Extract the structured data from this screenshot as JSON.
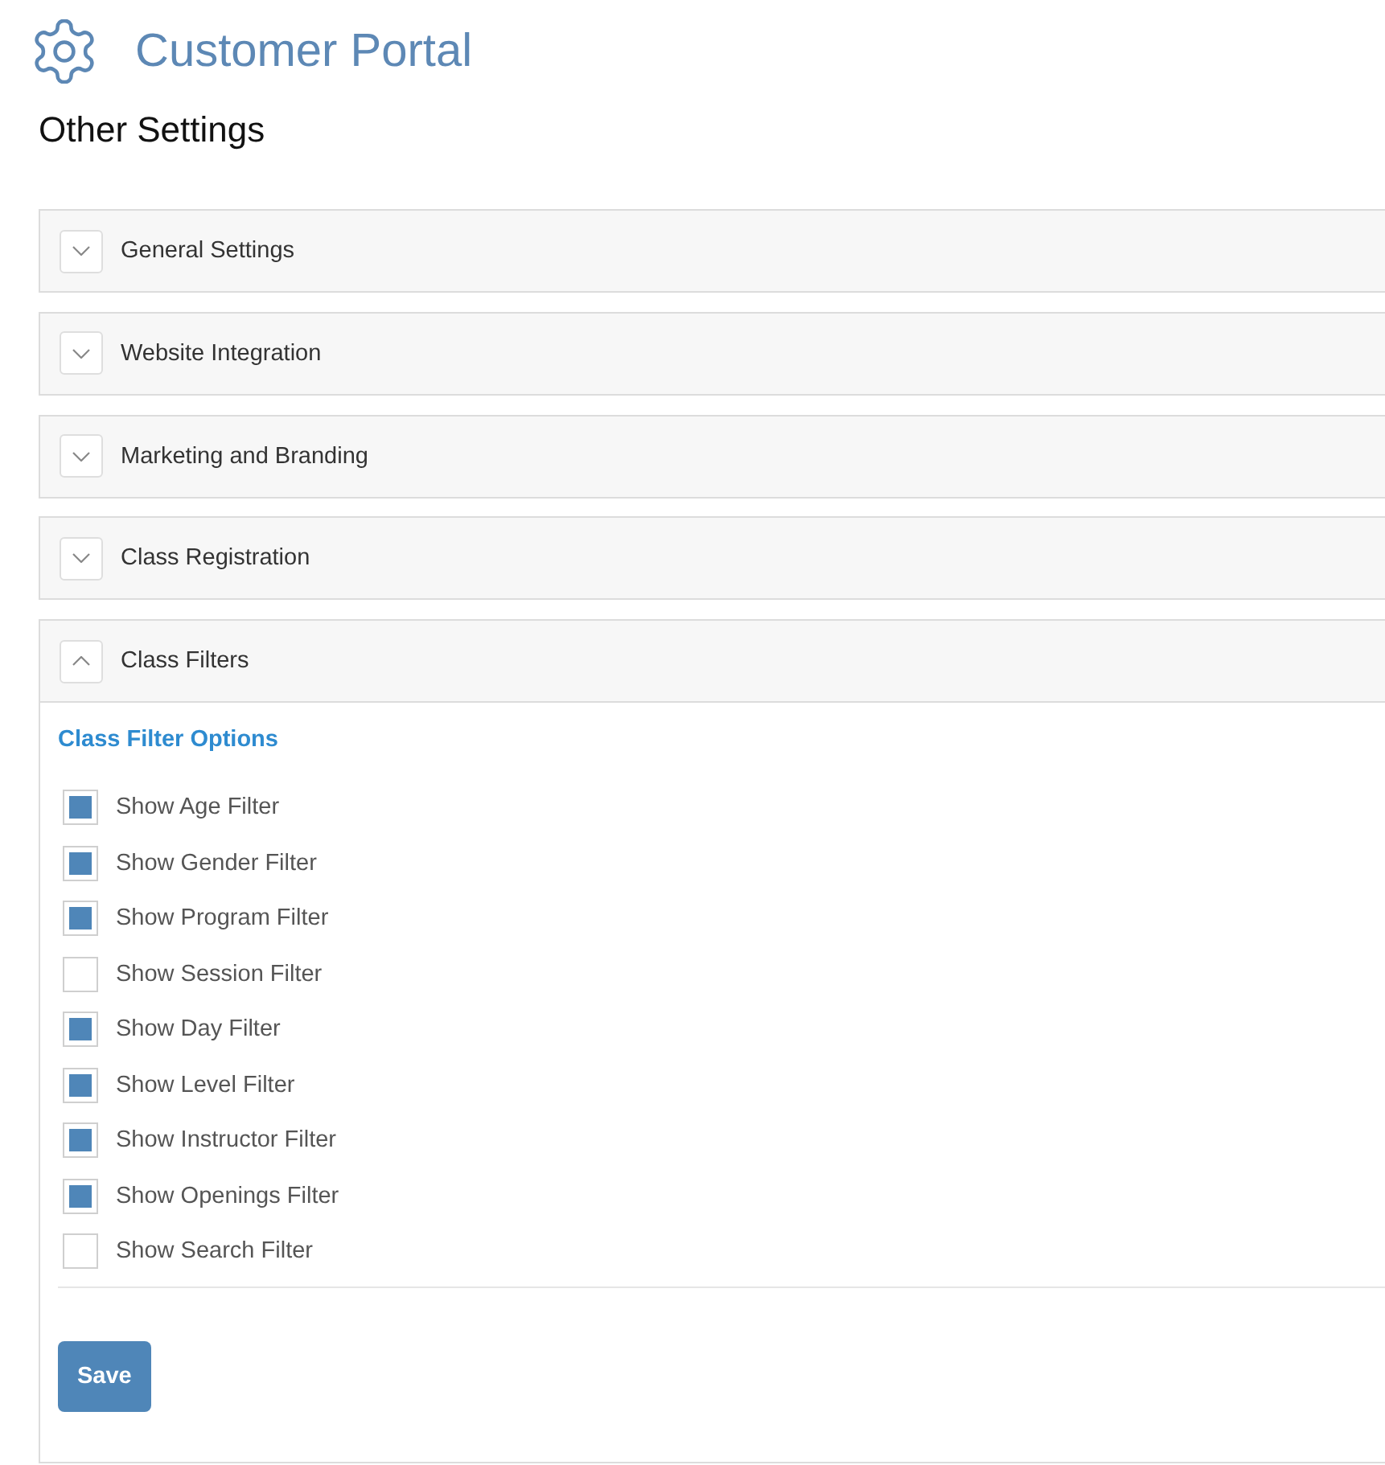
{
  "header": {
    "title": "Customer Portal"
  },
  "page_title": "Other Settings",
  "sections": [
    {
      "title": "General Settings",
      "expanded": false
    },
    {
      "title": "Website Integration",
      "expanded": false
    },
    {
      "title": "Marketing and Branding",
      "expanded": false
    },
    {
      "title": "Class Registration",
      "expanded": false
    },
    {
      "title": "Class Filters",
      "expanded": true,
      "content": {
        "heading": "Class Filter Options",
        "options": [
          {
            "label": "Show Age Filter",
            "checked": true
          },
          {
            "label": "Show Gender Filter",
            "checked": true
          },
          {
            "label": "Show Program Filter",
            "checked": true
          },
          {
            "label": "Show Session Filter",
            "checked": false
          },
          {
            "label": "Show Day Filter",
            "checked": true
          },
          {
            "label": "Show Level Filter",
            "checked": true
          },
          {
            "label": "Show Instructor Filter",
            "checked": true
          },
          {
            "label": "Show Openings Filter",
            "checked": true
          },
          {
            "label": "Show Search Filter",
            "checked": false
          }
        ],
        "save_button": {
          "label": "Save"
        }
      }
    }
  ]
}
